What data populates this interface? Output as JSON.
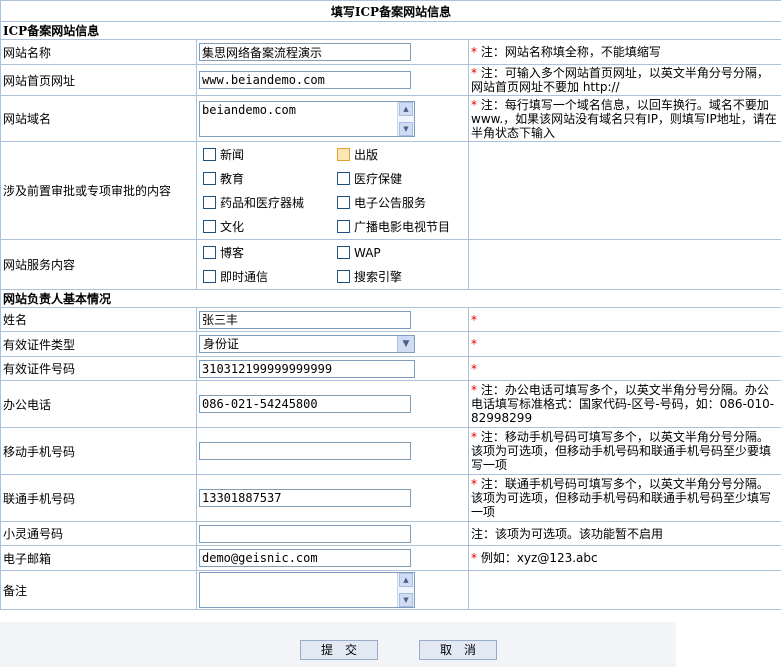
{
  "page_title": "填写ICP备案网站信息",
  "section1": "ICP备案网站信息",
  "section2": "网站负责人基本情况",
  "rows": {
    "name": {
      "label": "网站名称",
      "value": "集思网络备案流程演示",
      "note": "注：网站名称填全称，不能填缩写"
    },
    "home": {
      "label": "网站首页网址",
      "value": "www.beiandemo.com",
      "note": "注：可输入多个网站首页网址，以英文半角分号分隔，网站首页网址不要加 http://"
    },
    "domain": {
      "label": "网站域名",
      "value": "beiandemo.com",
      "note": "注：每行填写一个域名信息，以回车换行。域名不要加 www.，如果该网站没有域名只有IP，则填写IP地址，请在半角状态下输入"
    },
    "approval": {
      "label": "涉及前置审批或专项审批的内容",
      "options": [
        "新闻",
        "出版",
        "教育",
        "医疗保健",
        "药品和医疗器械",
        "电子公告服务",
        "文化",
        "广播电影电视节目"
      ]
    },
    "service": {
      "label": "网站服务内容",
      "options": [
        "博客",
        "WAP",
        "即时通信",
        "搜索引擎"
      ]
    },
    "person": {
      "label": "姓名",
      "value": "张三丰"
    },
    "idtype": {
      "label": "有效证件类型",
      "value": "身份证"
    },
    "idno": {
      "label": "有效证件号码",
      "value": "310312199999999999"
    },
    "office": {
      "label": "办公电话",
      "value": "086-021-54245800",
      "note": "注：办公电话可填写多个，以英文半角分号分隔。办公电话填写标准格式：国家代码-区号-号码，如：086-010-82998299"
    },
    "mobile": {
      "label": "移动手机号码",
      "value": "",
      "note": "注：移动手机号码可填写多个，以英文半角分号分隔。该项为可选项，但移动手机号码和联通手机号码至少要填写一项"
    },
    "unicom": {
      "label": "联通手机号码",
      "value": "13301887537",
      "note": "注：联通手机号码可填写多个，以英文半角分号分隔。该项为可选项，但移动手机号码和联通手机号码至少填写一项"
    },
    "phs": {
      "label": "小灵通号码",
      "value": "",
      "note": "注：该项为可选项。该功能暂不启用"
    },
    "email": {
      "label": "电子邮箱",
      "value": "demo@geisnic.com",
      "note": "例如：xyz@123.abc"
    },
    "remark": {
      "label": "备注",
      "value": ""
    }
  },
  "star": "*",
  "buttons": {
    "submit": "提　交",
    "cancel": "取　消"
  },
  "colors": {
    "header_bg": "#dbe8f6",
    "border": "#a9c3dc",
    "required": "#e00000"
  }
}
